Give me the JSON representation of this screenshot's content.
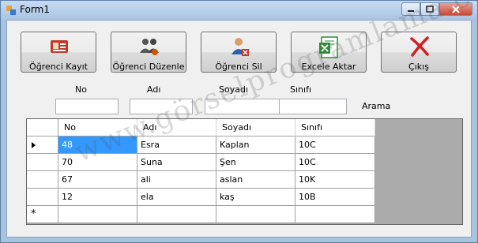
{
  "window": {
    "title": "Form1"
  },
  "toolbar": {
    "buttons": [
      {
        "label": "Öğrenci Kayıt",
        "icon": "id-card-icon"
      },
      {
        "label": "Öğrenci Düzenle",
        "icon": "users-edit-icon"
      },
      {
        "label": "Öğrenci Sil",
        "icon": "user-delete-icon"
      },
      {
        "label": "Excele Aktar",
        "icon": "excel-icon"
      },
      {
        "label": "Çıkış",
        "icon": "red-x-icon"
      }
    ]
  },
  "filters": {
    "no_label": "No",
    "adi_label": "Adı",
    "soyadi_label": "Soyadı",
    "sinifi_label": "Sınıfı",
    "arama_label": "Arama",
    "no_value": "",
    "adi_value": "",
    "soyadi_value": "",
    "sinifi_value": ""
  },
  "grid": {
    "columns": [
      "No",
      "Adı",
      "Soyadı",
      "Sınıfı"
    ],
    "rows": [
      [
        "48",
        "Esra",
        "Kaplan",
        "10C"
      ],
      [
        "70",
        "Suna",
        "Şen",
        "10C"
      ],
      [
        "67",
        "ali",
        "aslan",
        "10K"
      ],
      [
        "12",
        "ela",
        "kaş",
        "10B"
      ]
    ],
    "new_row_marker": "*"
  },
  "watermark": "www.görselprogramlama.com",
  "colors": {
    "selection": "#3399ff",
    "excel_green": "#2e8b3a",
    "exit_red": "#d21e1e"
  }
}
